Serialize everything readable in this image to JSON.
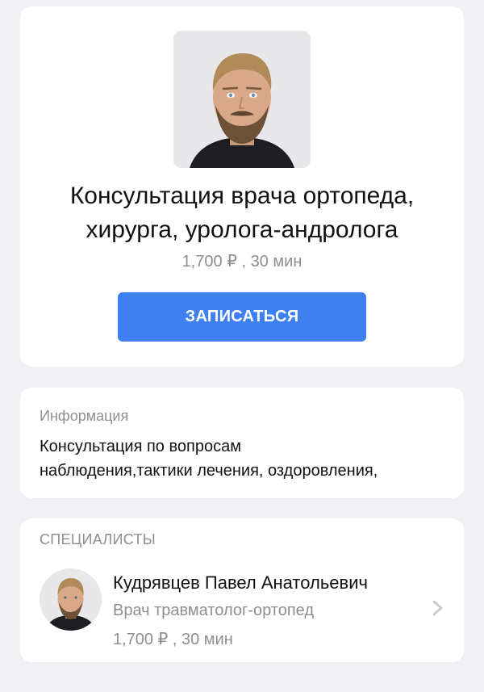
{
  "service": {
    "title_line1": "Консультация врача ортопеда,",
    "title_line2": "хирурга, уролога-андролога",
    "price_duration": "1,700 ₽ , 30 мин",
    "book_button_label": "ЗАПИСАТЬСЯ",
    "photo_icon": "doctor-portrait"
  },
  "info": {
    "label": "Информация",
    "text_line1": "Консультация по вопросам",
    "text_line2": "наблюдения,тактики лечения, оздоровления,"
  },
  "specialists": {
    "heading": "СПЕЦИАЛИСТЫ",
    "items": [
      {
        "name": "Кудрявцев Павел Анатольевич",
        "role": "Врач травматолог-ортопед",
        "price_duration": "1,700 ₽ , 30 мин",
        "avatar_icon": "doctor-avatar",
        "chevron_icon": "chevron-right-icon"
      }
    ]
  },
  "colors": {
    "page_background": "#f0f0f5",
    "card_background": "#ffffff",
    "accent_button": "#3e7ff1",
    "secondary_text": "#8e8e93",
    "primary_text": "#111111"
  }
}
